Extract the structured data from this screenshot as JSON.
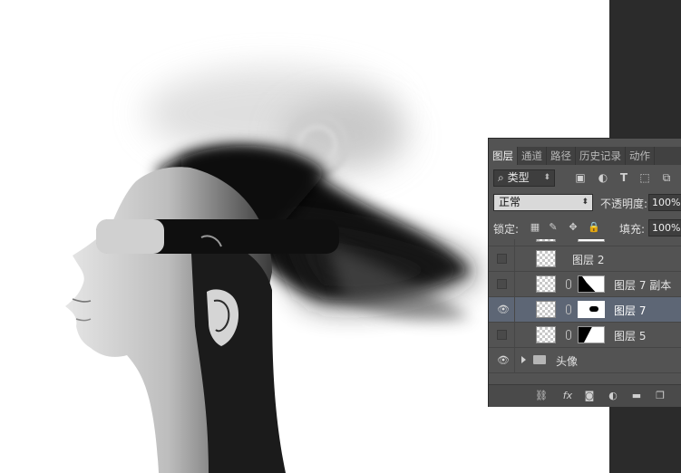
{
  "panel": {
    "tabs": [
      "图层",
      "通道",
      "路径",
      "历史记录",
      "动作"
    ],
    "filter": {
      "label": "类型",
      "icon": "search-icon"
    },
    "filter_icons": [
      "image-filter-icon",
      "adjustment-filter-icon",
      "text-filter-icon",
      "shape-filter-icon",
      "smart-object-filter-icon"
    ],
    "blend_mode": "正常",
    "opacity_label": "不透明度:",
    "opacity_value": "100%",
    "lock_label": "锁定:",
    "fill_label": "填充:",
    "fill_value": "100%",
    "layers": [
      {
        "name": "图层 2",
        "visible": false
      },
      {
        "name": "图层 7 副本",
        "visible": false
      },
      {
        "name": "图层 7",
        "visible": true,
        "selected": true
      },
      {
        "name": "图层 5",
        "visible": false
      },
      {
        "name": "头像",
        "visible": true,
        "type": "group"
      }
    ],
    "bottom_icons": [
      "link-layers-icon",
      "fx-icon",
      "add-mask-icon",
      "adjustment-layer-icon",
      "new-group-icon",
      "new-layer-icon"
    ],
    "fx_label": "fx"
  },
  "colors": {
    "panel_bg": "#535353",
    "tab_bar": "#414141",
    "selected_row": "#5d6675",
    "workspace_dark": "#2b2b2b"
  }
}
